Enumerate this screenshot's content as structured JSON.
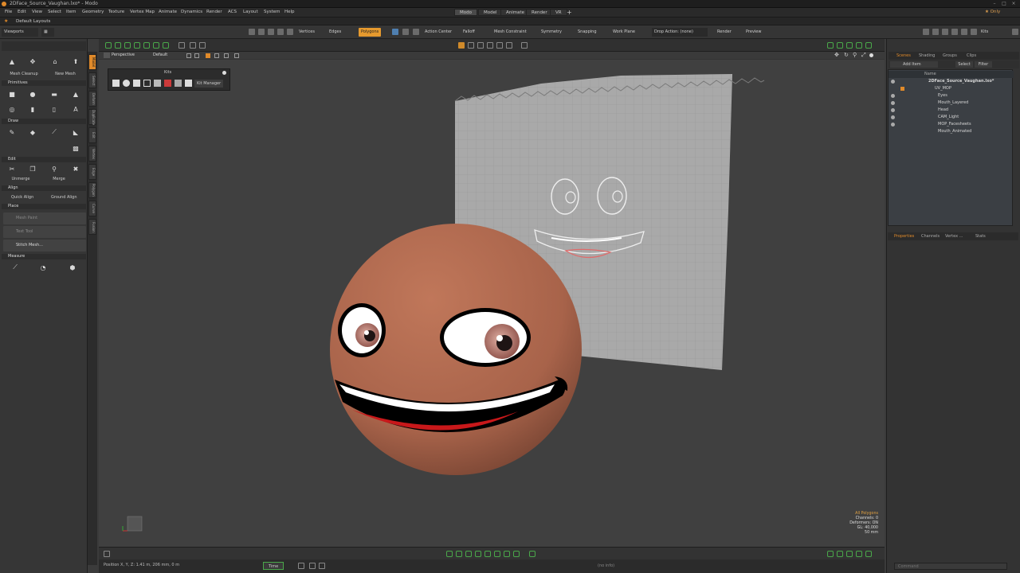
{
  "window": {
    "title": "2DFace_Source_Vaughan.lxo* - Modo"
  },
  "menu": [
    "File",
    "Edit",
    "View",
    "Select",
    "Item",
    "Geometry",
    "Texture",
    "Vertex Map",
    "Animate",
    "Dynamics",
    "Render",
    "ACS",
    "Layout",
    "System",
    "Help"
  ],
  "layout_tabs": [
    "Modo",
    "Model",
    "Animate",
    "Render",
    "VR"
  ],
  "layout_right": "★ Only",
  "layout_bar": {
    "label": "Default Layouts"
  },
  "viewports_label": "Viewports",
  "toolbar": {
    "vertices": "Vertices",
    "edges": "Edges",
    "polygons": "Polygons",
    "action_center": "Action Center",
    "falloff": "Falloff",
    "mesh_constraint": "Mesh Constraint",
    "symmetry": "Symmetry",
    "snapping": "Snapping",
    "work_plane": "Work Plane",
    "drop_action": "Drop Action: (none)",
    "render": "Render",
    "preview": "Preview",
    "kits": "Kits"
  },
  "left_panel": {
    "mesh_cleanup": "Mesh Cleanup",
    "new_mesh": "New Mesh",
    "primitives": "Primitives",
    "draw": "Draw",
    "edit": "Edit",
    "unmerge": "Unmerge",
    "merge": "Merge",
    "align": "Align",
    "quick_align": "Quick Align",
    "ground_align": "Ground Align",
    "place": "Place",
    "mesh_paint": "Mesh Paint",
    "text_tool": "Text Tool",
    "stitch_mesh": "Stitch Mesh...",
    "measure": "Measure"
  },
  "vtabs": [
    "Model",
    "Select",
    "Deform",
    "Duplicate",
    "Edit",
    "Vertex",
    "Edge",
    "Polygon",
    "Curve",
    "Fusion"
  ],
  "viewport": {
    "view_mode": "Perspective",
    "shading": "Default",
    "info": [
      "All Polygons",
      "Channels: 0",
      "Deformers: ON",
      "GL: 40,000",
      "50 mm"
    ]
  },
  "kits_popup": {
    "title": "Kits",
    "kit_manager": "Kit Manager"
  },
  "status": {
    "position": "Position X, Y, Z:  1.41 m, 206 mm, 0 m",
    "time": "Time",
    "no_info": "(no info)"
  },
  "scene": {
    "tabs": [
      "Scenes",
      "Shading",
      "Groups",
      "Clips"
    ],
    "add_item": "Add Item",
    "select": "Select",
    "filter": "Filter",
    "name_col": "Name",
    "items": [
      {
        "label": "2DFace_Source_Vaughan.lxo*",
        "indent": 0
      },
      {
        "label": "UV_MOP",
        "indent": 1
      },
      {
        "label": "Eyes",
        "indent": 2
      },
      {
        "label": "Mouth_Layered",
        "indent": 2
      },
      {
        "label": "Head",
        "indent": 2
      },
      {
        "label": "CAM_Light",
        "indent": 2
      },
      {
        "label": "MOP_Facesheets",
        "indent": 2
      },
      {
        "label": "Mouth_Animated",
        "indent": 2
      }
    ]
  },
  "props_tabs": [
    "Properties",
    "Channels",
    "Vertex ...",
    "Stats"
  ],
  "command_placeholder": "Command",
  "colors": {
    "accent": "#e08a2a",
    "head": "#b36d4f",
    "viewport": "#404040"
  }
}
